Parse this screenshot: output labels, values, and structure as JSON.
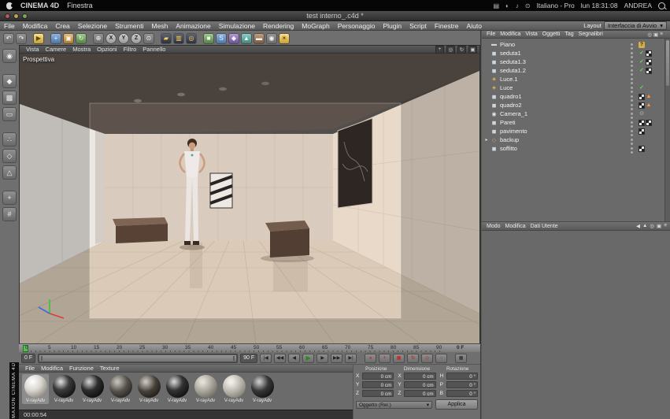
{
  "menubar": {
    "app_name": "CINEMA 4D",
    "menu_finestra": "Finestra",
    "input_label": "Italiano - Pro",
    "clock": "lun 18:31:08",
    "user": "ANDREA"
  },
  "window": {
    "title": "test interno_.c4d *"
  },
  "app_menu": {
    "items": [
      "File",
      "Modifica",
      "Crea",
      "Selezione",
      "Strumenti",
      "Mesh",
      "Animazione",
      "Simulazione",
      "Rendering",
      "MoGraph",
      "Personaggio",
      "Plugin",
      "Script",
      "Finestre",
      "Aiuto"
    ],
    "layout_label": "Layout",
    "layout_value": "Interfaccia di Avvio"
  },
  "toolbar": {
    "axis_x": "X",
    "axis_y": "Y",
    "axis_z": "Z"
  },
  "viewport": {
    "camera_label": "Prospettiva",
    "menus": [
      "Vista",
      "Camere",
      "Mostra",
      "Opzioni",
      "Filtro",
      "Pannello"
    ]
  },
  "object_manager": {
    "menus": [
      "File",
      "Modifica",
      "Vista",
      "Oggetti",
      "Tag",
      "Segnalibri"
    ],
    "objects": [
      {
        "name": "Piano"
      },
      {
        "name": "seduta1"
      },
      {
        "name": "seduta1.3"
      },
      {
        "name": "seduta1.2"
      },
      {
        "name": "Luce.1"
      },
      {
        "name": "Luce"
      },
      {
        "name": "quadro1"
      },
      {
        "name": "quadro2"
      },
      {
        "name": "Camera_1"
      },
      {
        "name": "Pareti"
      },
      {
        "name": "pavimento"
      },
      {
        "name": "backup"
      },
      {
        "name": "soffitto"
      }
    ]
  },
  "attribute_manager": {
    "menus": [
      "Modo",
      "Modifica",
      "Dati Utente"
    ]
  },
  "timeline": {
    "ticks": [
      "0",
      "5",
      "10",
      "15",
      "20",
      "25",
      "30",
      "35",
      "40",
      "45",
      "50",
      "55",
      "60",
      "65",
      "70",
      "75",
      "80",
      "85",
      "90"
    ],
    "end_label": "0 F",
    "range_start": "0 F",
    "range_end": "90 F"
  },
  "materials": {
    "menus": [
      "File",
      "Modifica",
      "Funzione",
      "Texture"
    ],
    "items": [
      {
        "name": "V-rayAdv"
      },
      {
        "name": "V-rayAdv"
      },
      {
        "name": "V-rayAdv"
      },
      {
        "name": "V-rayAdv"
      },
      {
        "name": "V-rayAdv"
      },
      {
        "name": "V-rayAdv"
      },
      {
        "name": "V-rayAdv"
      },
      {
        "name": "V-rayAdv"
      },
      {
        "name": "V-rayAdv"
      }
    ]
  },
  "coordinates": {
    "headers": [
      "Posizione",
      "Dimensione",
      "Rotazione"
    ],
    "pos": {
      "x_label": "X",
      "y_label": "Y",
      "z_label": "Z",
      "x": "0 cm",
      "y": "0 cm",
      "z": "0 cm"
    },
    "size": {
      "x_label": "X",
      "y_label": "Y",
      "z_label": "Z",
      "x": "0 cm",
      "y": "0 cm",
      "z": "0 cm"
    },
    "rot": {
      "h_label": "H",
      "p_label": "P",
      "b_label": "B",
      "h": "0 °",
      "p": "0 °",
      "b": "0 °"
    },
    "space": "Oggetto (Rel.)",
    "apply": "Applica"
  },
  "status": {
    "time": "00:00:54"
  },
  "branding": {
    "maxon": "MAXON  CINEMA 4D"
  },
  "colors": {
    "accent_green": "#56c04e",
    "warning_orange": "#ff9b30",
    "ui_gray": "#6f6f6f"
  },
  "icons": {
    "volume": "♪",
    "display": "▤",
    "bluetooth": "◐",
    "wifi": "⊙",
    "undo": "↶",
    "redo": "↷",
    "selection": "▶",
    "move": "+",
    "scale": "▣",
    "rotate": "↻",
    "coords": "⊕",
    "world": "⊙",
    "render_view": "▰",
    "render_pv": "▥",
    "render_settings": "◎",
    "cube": "■",
    "spline": "S",
    "nurbs": "◆",
    "mograph": "▲",
    "floor": "▬",
    "camera": "◉",
    "light": "☀",
    "editable": "◉",
    "model": "◆",
    "texture": "▩",
    "workplane": "▭",
    "points": "∴",
    "edges": "◇",
    "polys": "△",
    "axis": "+",
    "snap": "#",
    "pan": "+",
    "orbit": "↻",
    "zoom": "◎",
    "toggle": "▣",
    "t_start": "|◀",
    "t_pkey": "◀◀",
    "t_pframe": "◀",
    "t_play": "▶",
    "t_nframe": "▶",
    "t_nkey": "▶▶",
    "t_end": "▶|",
    "record": "●",
    "key_pos": "+",
    "key_scale": "▣",
    "key_rot": "↻",
    "key_param": "◇",
    "autokey": "○",
    "extra": "▦",
    "search": "◎",
    "lock": "▣",
    "panel_menu": "≡",
    "arrow_left": "◀",
    "arrow_up": "▲",
    "check": "✓",
    "warning": "▲",
    "question": "?",
    "target": "⊙",
    "expand": "▸",
    "plane": "▬",
    "cube_s": "◼",
    "light_s": "☀",
    "camera_s": "◉",
    "null_s": "◇",
    "combo_arrow": "▾"
  }
}
